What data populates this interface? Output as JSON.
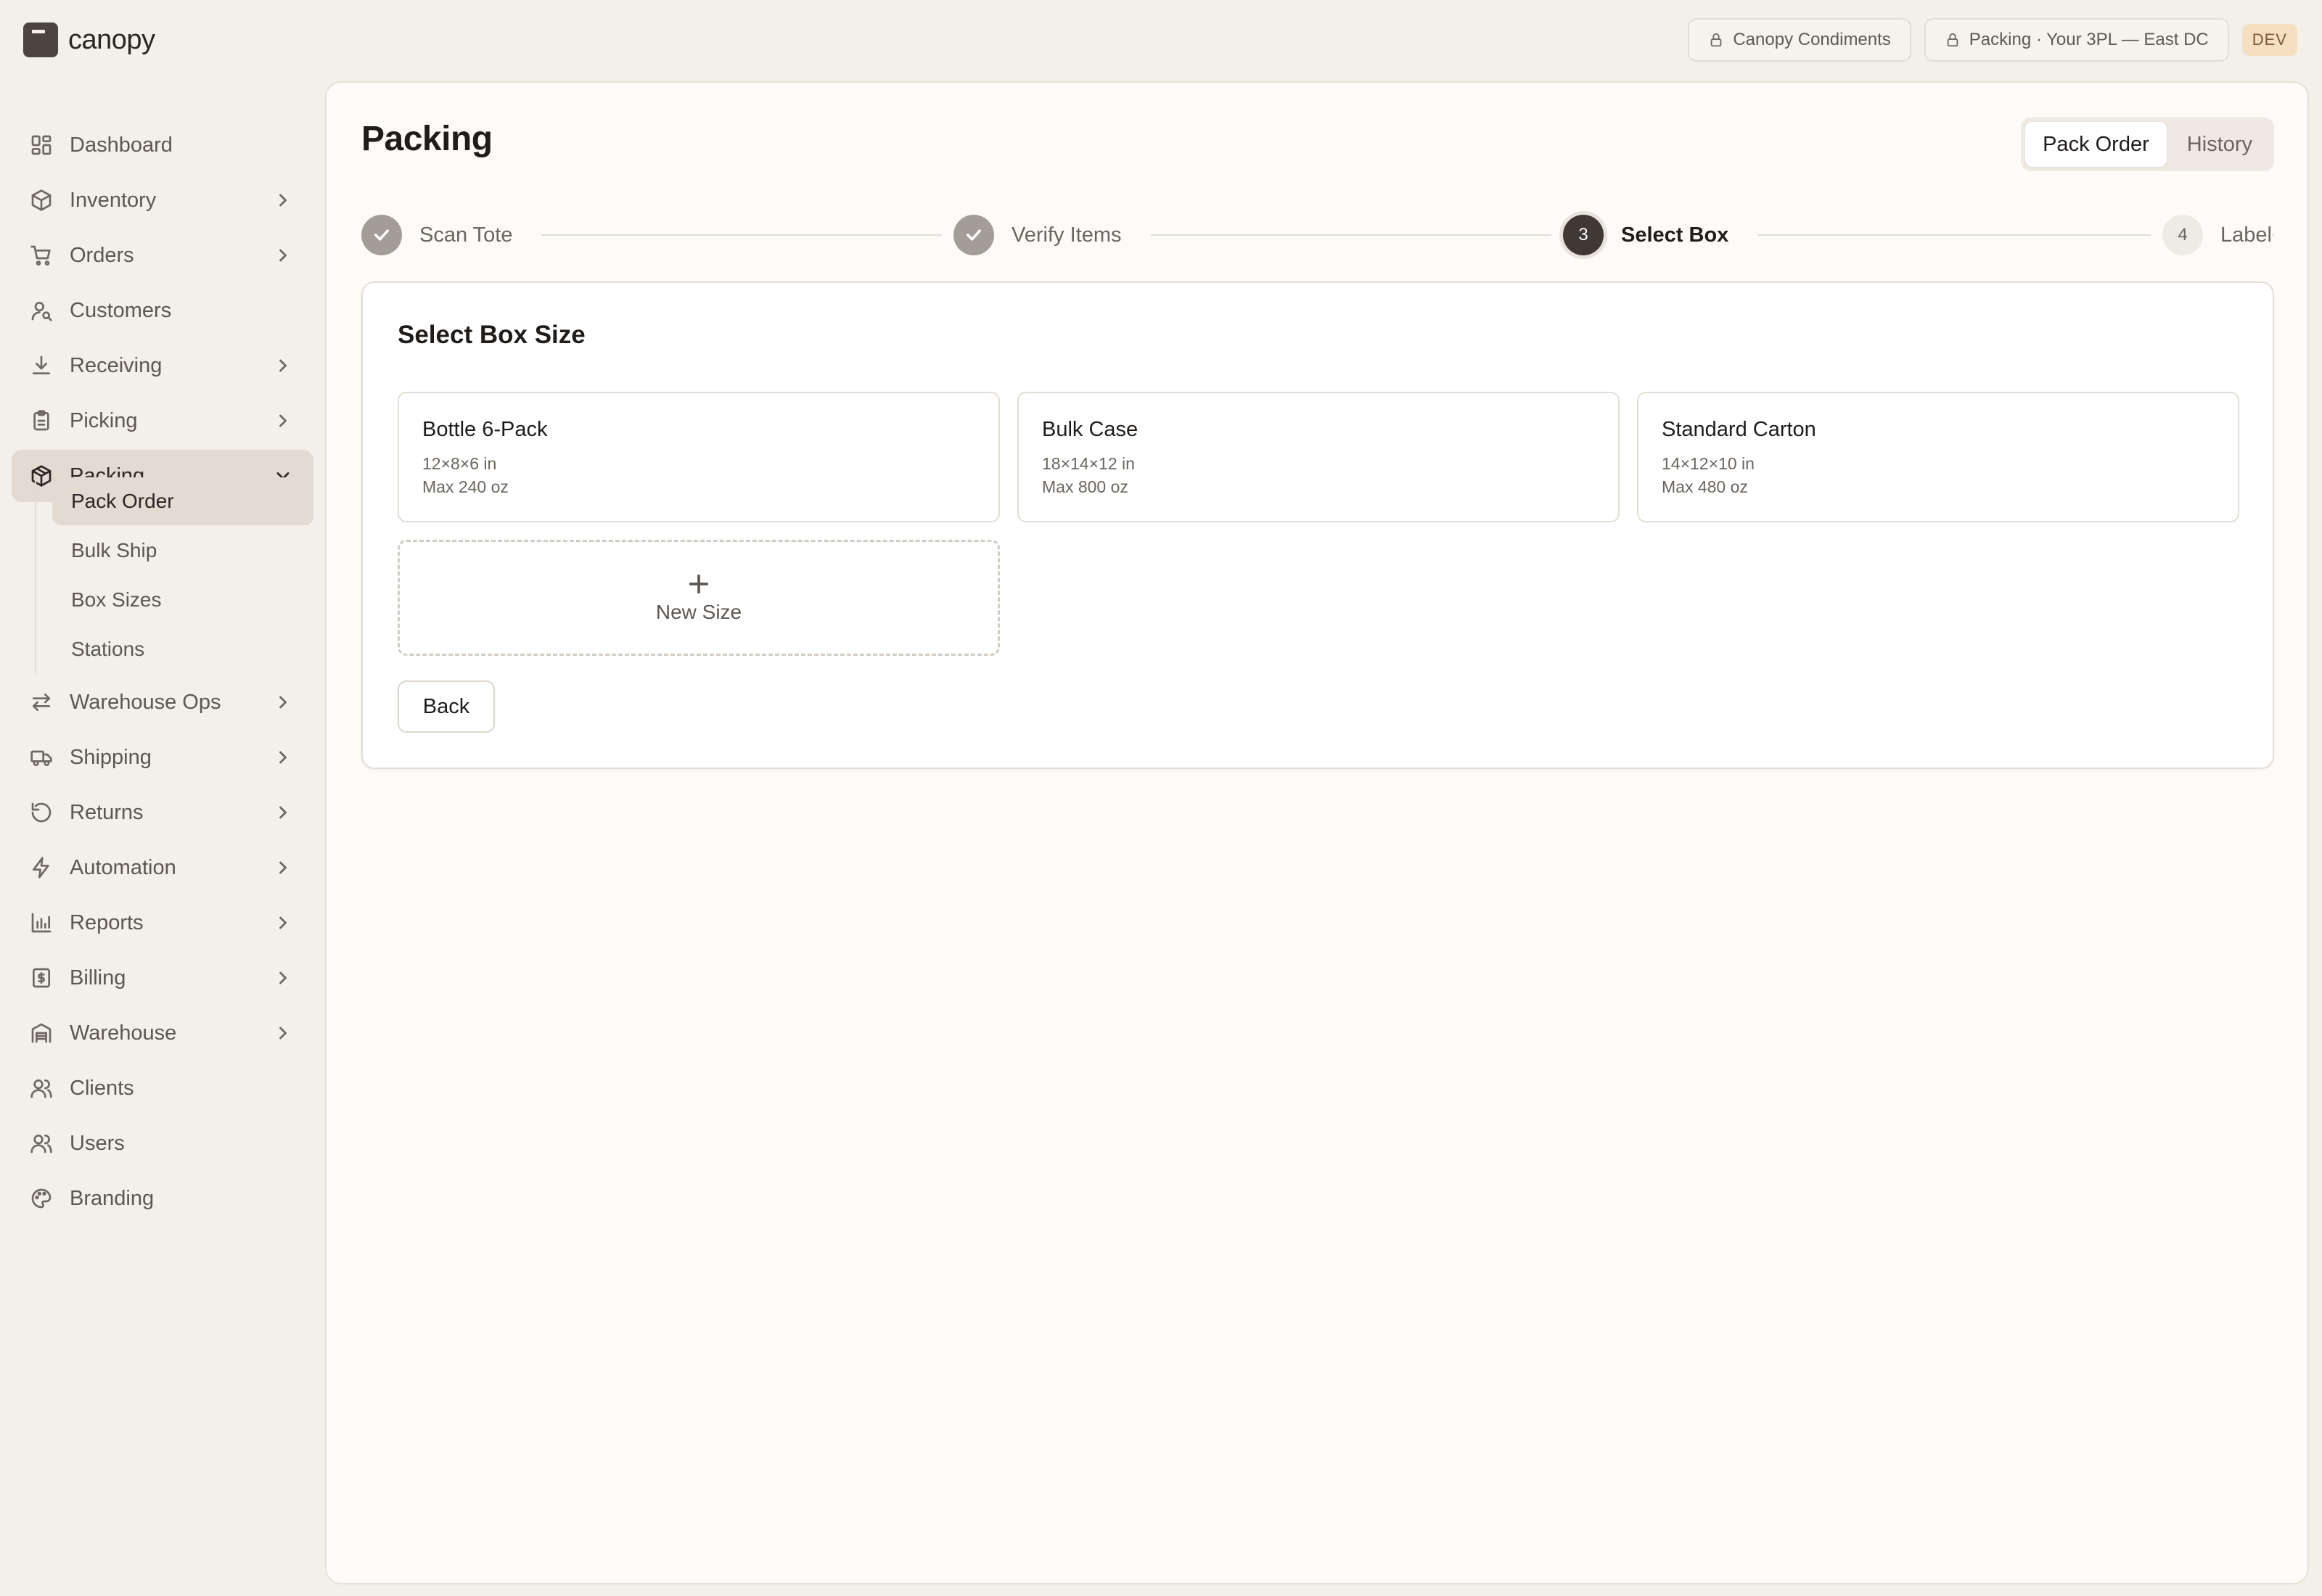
{
  "brand": {
    "name": "canopy"
  },
  "header": {
    "client_pill": "Canopy Condiments",
    "context_pill": "Packing · Your 3PL — East DC",
    "env_badge": "DEV"
  },
  "sidebar": {
    "items": [
      {
        "label": "Dashboard",
        "icon": "dashboard-icon"
      },
      {
        "label": "Inventory",
        "icon": "box-icon"
      },
      {
        "label": "Orders",
        "icon": "cart-icon"
      },
      {
        "label": "Customers",
        "icon": "customer-icon"
      },
      {
        "label": "Receiving",
        "icon": "download-icon"
      },
      {
        "label": "Picking",
        "icon": "clipboard-icon"
      },
      {
        "label": "Packing",
        "icon": "package-icon"
      },
      {
        "label": "Warehouse Ops",
        "icon": "arrows-icon"
      },
      {
        "label": "Shipping",
        "icon": "truck-icon"
      },
      {
        "label": "Returns",
        "icon": "return-icon"
      },
      {
        "label": "Automation",
        "icon": "bolt-icon"
      },
      {
        "label": "Reports",
        "icon": "chart-icon"
      },
      {
        "label": "Billing",
        "icon": "billing-icon"
      },
      {
        "label": "Warehouse",
        "icon": "warehouse-icon"
      },
      {
        "label": "Clients",
        "icon": "clients-icon"
      },
      {
        "label": "Users",
        "icon": "users-icon"
      },
      {
        "label": "Branding",
        "icon": "palette-icon"
      }
    ],
    "packing_sub": [
      {
        "label": "Pack Order"
      },
      {
        "label": "Bulk Ship"
      },
      {
        "label": "Box Sizes"
      },
      {
        "label": "Stations"
      }
    ]
  },
  "main": {
    "title": "Packing",
    "tabs": [
      {
        "label": "Pack Order"
      },
      {
        "label": "History"
      }
    ],
    "steps": [
      {
        "label": "Scan Tote",
        "state": "done"
      },
      {
        "label": "Verify Items",
        "state": "done"
      },
      {
        "label": "Select Box",
        "state": "current",
        "number": "3"
      },
      {
        "label": "Label",
        "state": "todo",
        "number": "4"
      }
    ],
    "card": {
      "title": "Select Box Size",
      "boxes": [
        {
          "name": "Bottle 6-Pack",
          "dims": "12×8×6 in",
          "max": "Max 240 oz"
        },
        {
          "name": "Bulk Case",
          "dims": "18×14×12 in",
          "max": "Max 800 oz"
        },
        {
          "name": "Standard Carton",
          "dims": "14×12×10 in",
          "max": "Max 480 oz"
        }
      ],
      "new_size_label": "New Size",
      "back_label": "Back"
    }
  }
}
